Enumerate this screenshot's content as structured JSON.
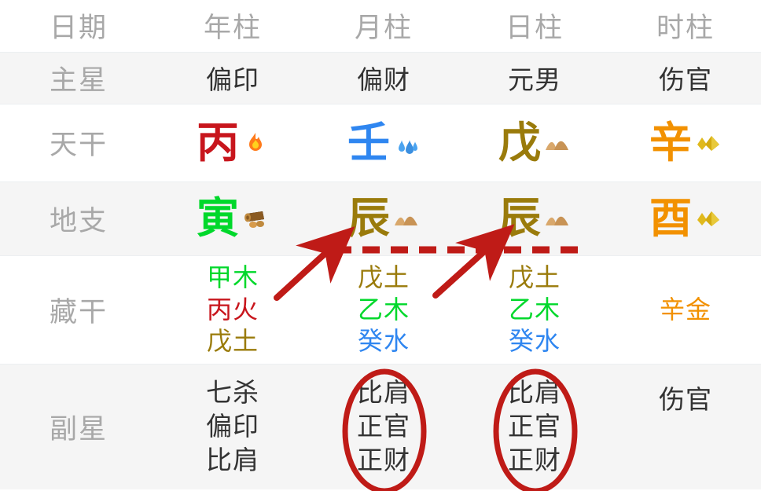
{
  "table": {
    "header": {
      "label": "日期",
      "pillars": [
        "年柱",
        "月柱",
        "日柱",
        "时柱"
      ]
    },
    "rows": [
      {
        "key": "main_star",
        "label": "主星",
        "values": [
          "偏印",
          "偏财",
          "元男",
          "伤官"
        ]
      },
      {
        "key": "heavenly_stems",
        "label": "天干",
        "cells": [
          {
            "char": "丙",
            "color": "#c8161d",
            "element": "fire",
            "emoji": "fire-emoji"
          },
          {
            "char": "壬",
            "color": "#2f86f0",
            "element": "water",
            "emoji": "water-drops-emoji"
          },
          {
            "char": "戊",
            "color": "#9a7b0b",
            "element": "earth",
            "emoji": "earth-mound-emoji"
          },
          {
            "char": "辛",
            "color": "#f29100",
            "element": "metal",
            "emoji": "metal-gems-emoji"
          }
        ]
      },
      {
        "key": "earthly_branches",
        "label": "地支",
        "cells": [
          {
            "char": "寅",
            "color": "#00d82b",
            "element": "wood",
            "emoji": "wood-log-emoji"
          },
          {
            "char": "辰",
            "color": "#9a7b0b",
            "element": "earth",
            "emoji": "earth-mound-emoji"
          },
          {
            "char": "辰",
            "color": "#9a7b0b",
            "element": "earth",
            "emoji": "earth-mound-emoji"
          },
          {
            "char": "酉",
            "color": "#f29100",
            "element": "metal",
            "emoji": "metal-gems-emoji"
          }
        ]
      },
      {
        "key": "hidden_stems",
        "label": "藏干",
        "columns": [
          [
            {
              "text": "甲木",
              "color": "#00d82b"
            },
            {
              "text": "丙火",
              "color": "#c8161d"
            },
            {
              "text": "戊土",
              "color": "#9a7b0b"
            }
          ],
          [
            {
              "text": "戊土",
              "color": "#9a7b0b"
            },
            {
              "text": "乙木",
              "color": "#00d82b"
            },
            {
              "text": "癸水",
              "color": "#2f86f0"
            }
          ],
          [
            {
              "text": "戊土",
              "color": "#9a7b0b"
            },
            {
              "text": "乙木",
              "color": "#00d82b"
            },
            {
              "text": "癸水",
              "color": "#2f86f0"
            }
          ],
          [
            {
              "text": "辛金",
              "color": "#f29100"
            }
          ]
        ]
      },
      {
        "key": "auxiliary_stars",
        "label": "副星",
        "columns": [
          [
            "七杀",
            "偏印",
            "比肩"
          ],
          [
            "比肩",
            "正官",
            "正财"
          ],
          [
            "比肩",
            "正官",
            "正财"
          ],
          [
            "伤官"
          ]
        ]
      }
    ]
  },
  "annotations": {
    "color": "#bf1b17",
    "dashed_line": {
      "name": "dashed-connector-line"
    },
    "arrows": [
      {
        "name": "arrow-to-month-branch"
      },
      {
        "name": "arrow-to-day-branch"
      }
    ],
    "ellipses": [
      {
        "name": "highlight-ellipse-month-aux-stars"
      },
      {
        "name": "highlight-ellipse-day-aux-stars"
      }
    ]
  },
  "colors": {
    "wood": "#00d82b",
    "fire": "#c8161d",
    "earth": "#9a7b0b",
    "metal": "#f29100",
    "water": "#2f86f0",
    "label_gray": "#a8a8a8",
    "text_dark": "#333333",
    "stripe": "#f5f5f5",
    "annotation_red": "#bf1b17"
  }
}
